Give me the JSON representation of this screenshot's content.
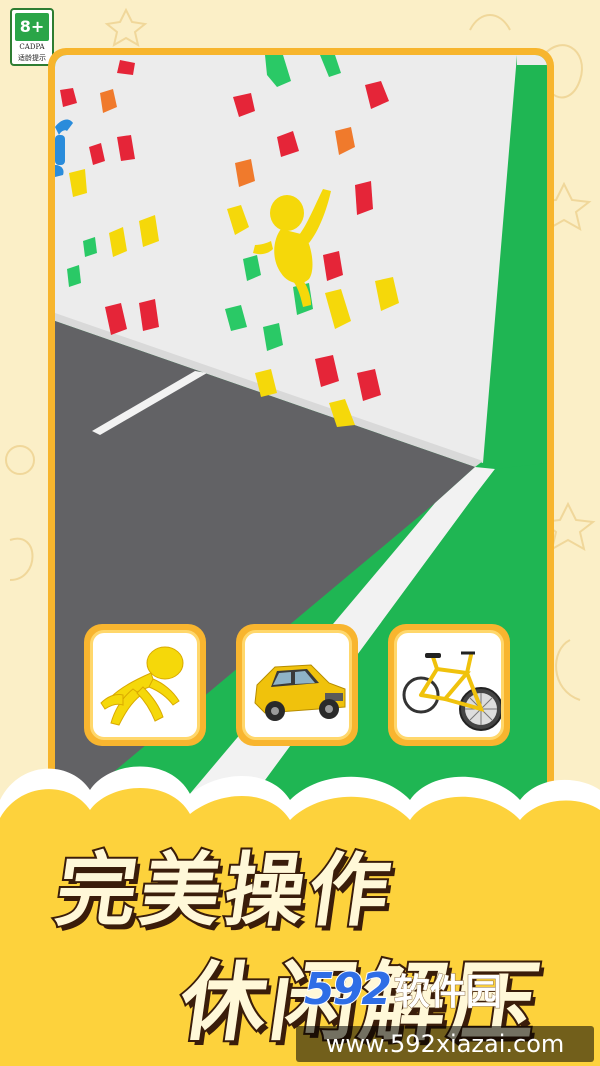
{
  "age_rating": {
    "label": "8+",
    "org": "CADPA",
    "tip": "适龄提示"
  },
  "slogan": {
    "line1": "完美操作",
    "line2": "休闲解压"
  },
  "modes": [
    {
      "name": "runner-mode",
      "icon": "yellow-stickman-runner-icon"
    },
    {
      "name": "car-mode",
      "icon": "yellow-car-icon"
    },
    {
      "name": "bike-mode",
      "icon": "yellow-bicycle-icon"
    }
  ],
  "watermark": {
    "digits": "592",
    "text": "软件园",
    "url": "www.592xiazai.com"
  },
  "colors": {
    "frame": "#f7b52d",
    "wall": "#ececec",
    "road": "#626265",
    "grass": "#1fb653",
    "character": "#f5d80a",
    "background": "#fbefc7"
  }
}
